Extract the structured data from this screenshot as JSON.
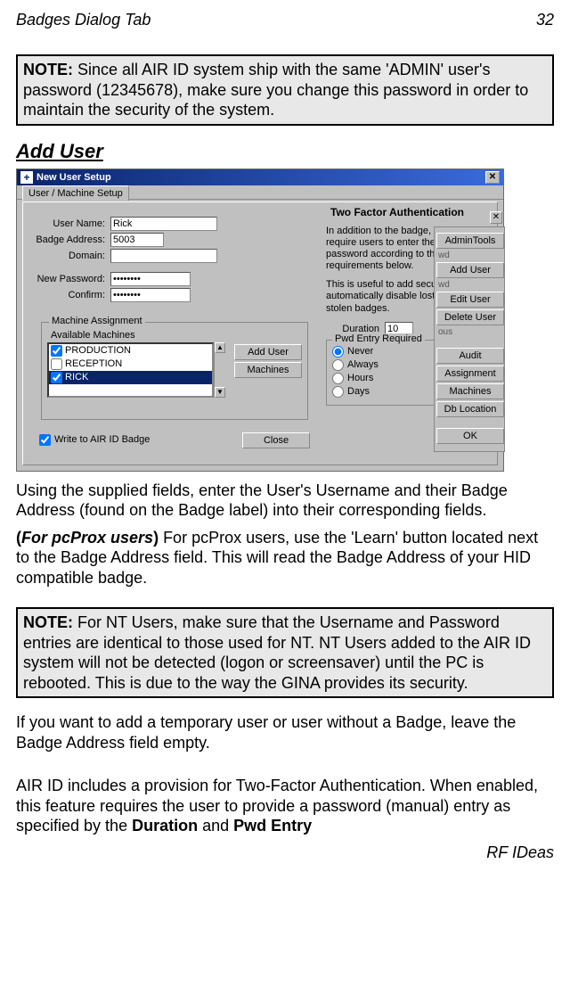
{
  "page": {
    "header_left": "Badges Dialog Tab",
    "header_right": "32",
    "footer": "RF IDeas"
  },
  "note1": {
    "label": "NOTE:",
    "text": " Since all AIR ID system ship with the same 'ADMIN' user's password (12345678), make sure you change this password in order to maintain the security of the system."
  },
  "section_heading": "Add User",
  "paragraphs": {
    "p1": "Using the supplied fields, enter the User's Username and their Badge Address (found on the Badge label) into their corresponding fields.",
    "p2_prefix": "(",
    "p2_bolditalic": "For pcProx users",
    "p2_suffix": ") For pcProx users, use the 'Learn' button located next to the Badge Address field.  This will read the Badge Address of your HID compatible badge.",
    "p3": "If you want to add a temporary user or user without a Badge, leave the Badge Address field empty.",
    "p4_a": "AIR ID includes a provision for Two-Factor Authentication.  When enabled, this feature requires the user to provide a password (manual) entry as specified by the ",
    "p4_b1": "Duration",
    "p4_mid": " and ",
    "p4_b2": "Pwd Entry"
  },
  "note2": {
    "label": "NOTE:",
    "text": " For NT Users, make sure that the Username and Password entries are identical to those used for NT.  NT Users added to the AIR ID system will not be detected (logon or screensaver) until the PC is rebooted.  This is due to the way the GINA provides its security."
  },
  "dialog": {
    "title": "New User Setup",
    "tab": "User / Machine Setup",
    "labels": {
      "username": "User Name:",
      "badge": "Badge Address:",
      "domain": "Domain:",
      "newpwd": "New Password:",
      "confirm": "Confirm:"
    },
    "values": {
      "username": "Rick",
      "badge": "5003",
      "domain": "",
      "newpwd": "********",
      "confirm": "********"
    },
    "machine_group": "Machine Assignment",
    "available_label": "Available Machines",
    "machines": [
      "PRODUCTION",
      "RECEPTION",
      "RICK"
    ],
    "write_checkbox": "Write to AIR ID Badge",
    "buttons": {
      "adduser": "Add User",
      "machines": "Machines",
      "close": "Close"
    },
    "tfa": {
      "heading": "Two Factor Authentication",
      "p1": "In addition to the badge, you can require users to enter their password according to the requirements below.",
      "p2": "This is useful to add security or automatically disable lost or stolen badges.",
      "duration_label": "Duration",
      "duration_value": "10",
      "radio_legend": "Pwd Entry Required",
      "radios": [
        "Never",
        "Always",
        "Hours",
        "Days"
      ]
    },
    "back": {
      "stubs": [
        "wd",
        "wd",
        "ous"
      ],
      "buttons": [
        "AdminTools",
        "Add User",
        "Edit User",
        "Delete User",
        "Audit",
        "Assignment",
        "Machines",
        "Db Location",
        "OK"
      ]
    }
  }
}
